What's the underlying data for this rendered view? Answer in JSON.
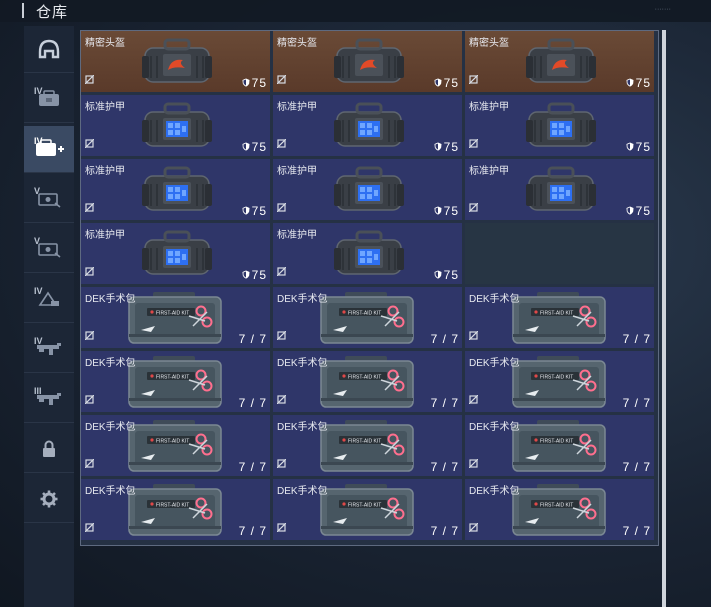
{
  "header": {
    "title": "仓库",
    "right_text": "·······"
  },
  "sidebar": {
    "tabs": [
      {
        "name": "helmet",
        "tier": "",
        "icon": "helmet-icon",
        "active": false
      },
      {
        "name": "backpack-iv",
        "tier": "IV",
        "icon": "backpack-icon",
        "active": false
      },
      {
        "name": "backpack-iv-plus",
        "tier": "IV",
        "icon": "backpack-plus-icon",
        "active": true
      },
      {
        "name": "ticket-v-1",
        "tier": "V",
        "icon": "ticket-icon",
        "active": false
      },
      {
        "name": "ticket-v-2",
        "tier": "V",
        "icon": "ticket-icon",
        "active": false
      },
      {
        "name": "tag-iv",
        "tier": "IV",
        "icon": "tag-icon",
        "active": false
      },
      {
        "name": "gun-iv",
        "tier": "IV",
        "icon": "gun-icon",
        "active": false
      },
      {
        "name": "gun-iii",
        "tier": "III",
        "icon": "gun-icon",
        "active": false
      },
      {
        "name": "lock",
        "tier": "",
        "icon": "lock-icon",
        "active": false
      },
      {
        "name": "settings",
        "tier": "",
        "icon": "gear-icon",
        "active": false
      }
    ]
  },
  "grid": {
    "items": [
      {
        "type": "helmet",
        "name": "精密头盔",
        "value": "75"
      },
      {
        "type": "helmet",
        "name": "精密头盔",
        "value": "75"
      },
      {
        "type": "helmet",
        "name": "精密头盔",
        "value": "75"
      },
      {
        "type": "armor",
        "name": "标准护甲",
        "value": "75"
      },
      {
        "type": "armor",
        "name": "标准护甲",
        "value": "75"
      },
      {
        "type": "armor",
        "name": "标准护甲",
        "value": "75"
      },
      {
        "type": "armor",
        "name": "标准护甲",
        "value": "75"
      },
      {
        "type": "armor",
        "name": "标准护甲",
        "value": "75"
      },
      {
        "type": "armor",
        "name": "标准护甲",
        "value": "75"
      },
      {
        "type": "armor",
        "name": "标准护甲",
        "value": "75"
      },
      {
        "type": "armor",
        "name": "标准护甲",
        "value": "75"
      },
      {
        "type": "empty",
        "name": "",
        "value": ""
      },
      {
        "type": "kit",
        "name": "DEK手术包",
        "value": "7/7"
      },
      {
        "type": "kit",
        "name": "DEK手术包",
        "value": "7/7"
      },
      {
        "type": "kit",
        "name": "DEK手术包",
        "value": "7/7"
      },
      {
        "type": "kit",
        "name": "DEK手术包",
        "value": "7/7"
      },
      {
        "type": "kit",
        "name": "DEK手术包",
        "value": "7/7"
      },
      {
        "type": "kit",
        "name": "DEK手术包",
        "value": "7/7"
      },
      {
        "type": "kit",
        "name": "DEK手术包",
        "value": "7/7"
      },
      {
        "type": "kit",
        "name": "DEK手术包",
        "value": "7/7"
      },
      {
        "type": "kit",
        "name": "DEK手术包",
        "value": "7/7"
      },
      {
        "type": "kit",
        "name": "DEK手术包",
        "value": "7/7"
      },
      {
        "type": "kit",
        "name": "DEK手术包",
        "value": "7/7"
      },
      {
        "type": "kit",
        "name": "DEK手术包",
        "value": "7/7"
      }
    ],
    "kit_label": "FIRST-AID KIT"
  },
  "colors": {
    "helmet_bg": "#6a4a36",
    "armor_bg": "#2f3669",
    "empty_bg": "#273544",
    "active_tab": "#3a4a63"
  }
}
